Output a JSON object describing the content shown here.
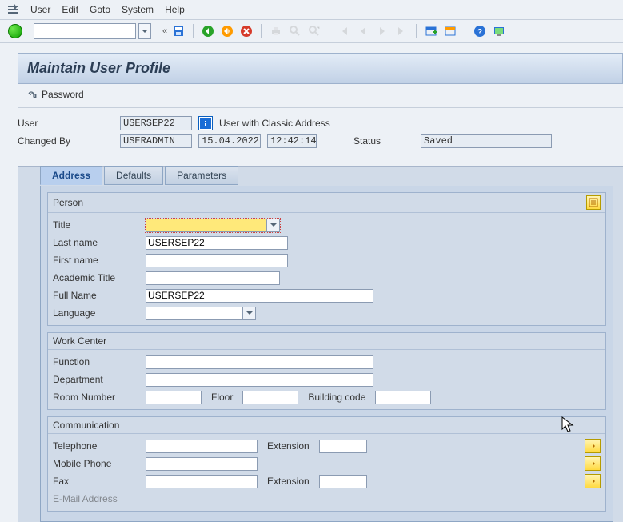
{
  "menubar": {
    "items": [
      "User",
      "Edit",
      "Goto",
      "System",
      "Help"
    ]
  },
  "page_title": "Maintain User Profile",
  "password_button": "Password",
  "header": {
    "user_label": "User",
    "user_value": "USERSEP22",
    "classic_addr": "User with Classic Address",
    "changed_by_label": "Changed By",
    "changed_by_value": "USERADMIN",
    "changed_date": "15.04.2022",
    "changed_time": "12:42:14",
    "status_label": "Status",
    "status_value": "Saved"
  },
  "tabs": {
    "address": "Address",
    "defaults": "Defaults",
    "parameters": "Parameters"
  },
  "person": {
    "title_group": "Person",
    "title_label": "Title",
    "title_value": "",
    "last_name_label": "Last name",
    "last_name_value": "USERSEP22",
    "first_name_label": "First name",
    "first_name_value": "",
    "academic_label": "Academic Title",
    "academic_value": "",
    "full_name_label": "Full Name",
    "full_name_value": "USERSEP22",
    "language_label": "Language",
    "language_value": ""
  },
  "workcenter": {
    "title_group": "Work Center",
    "function_label": "Function",
    "function_value": "",
    "department_label": "Department",
    "department_value": "",
    "room_label": "Room Number",
    "room_value": "",
    "floor_label": "Floor",
    "floor_value": "",
    "building_label": "Building code",
    "building_value": ""
  },
  "communication": {
    "title_group": "Communication",
    "telephone_label": "Telephone",
    "telephone_value": "",
    "extension_label": "Extension",
    "extension_value": "",
    "mobile_label": "Mobile Phone",
    "mobile_value": "",
    "fax_label": "Fax",
    "fax_value": "",
    "fax_ext_label": "Extension",
    "fax_ext_value": "",
    "email_label": "E-Mail Address"
  }
}
